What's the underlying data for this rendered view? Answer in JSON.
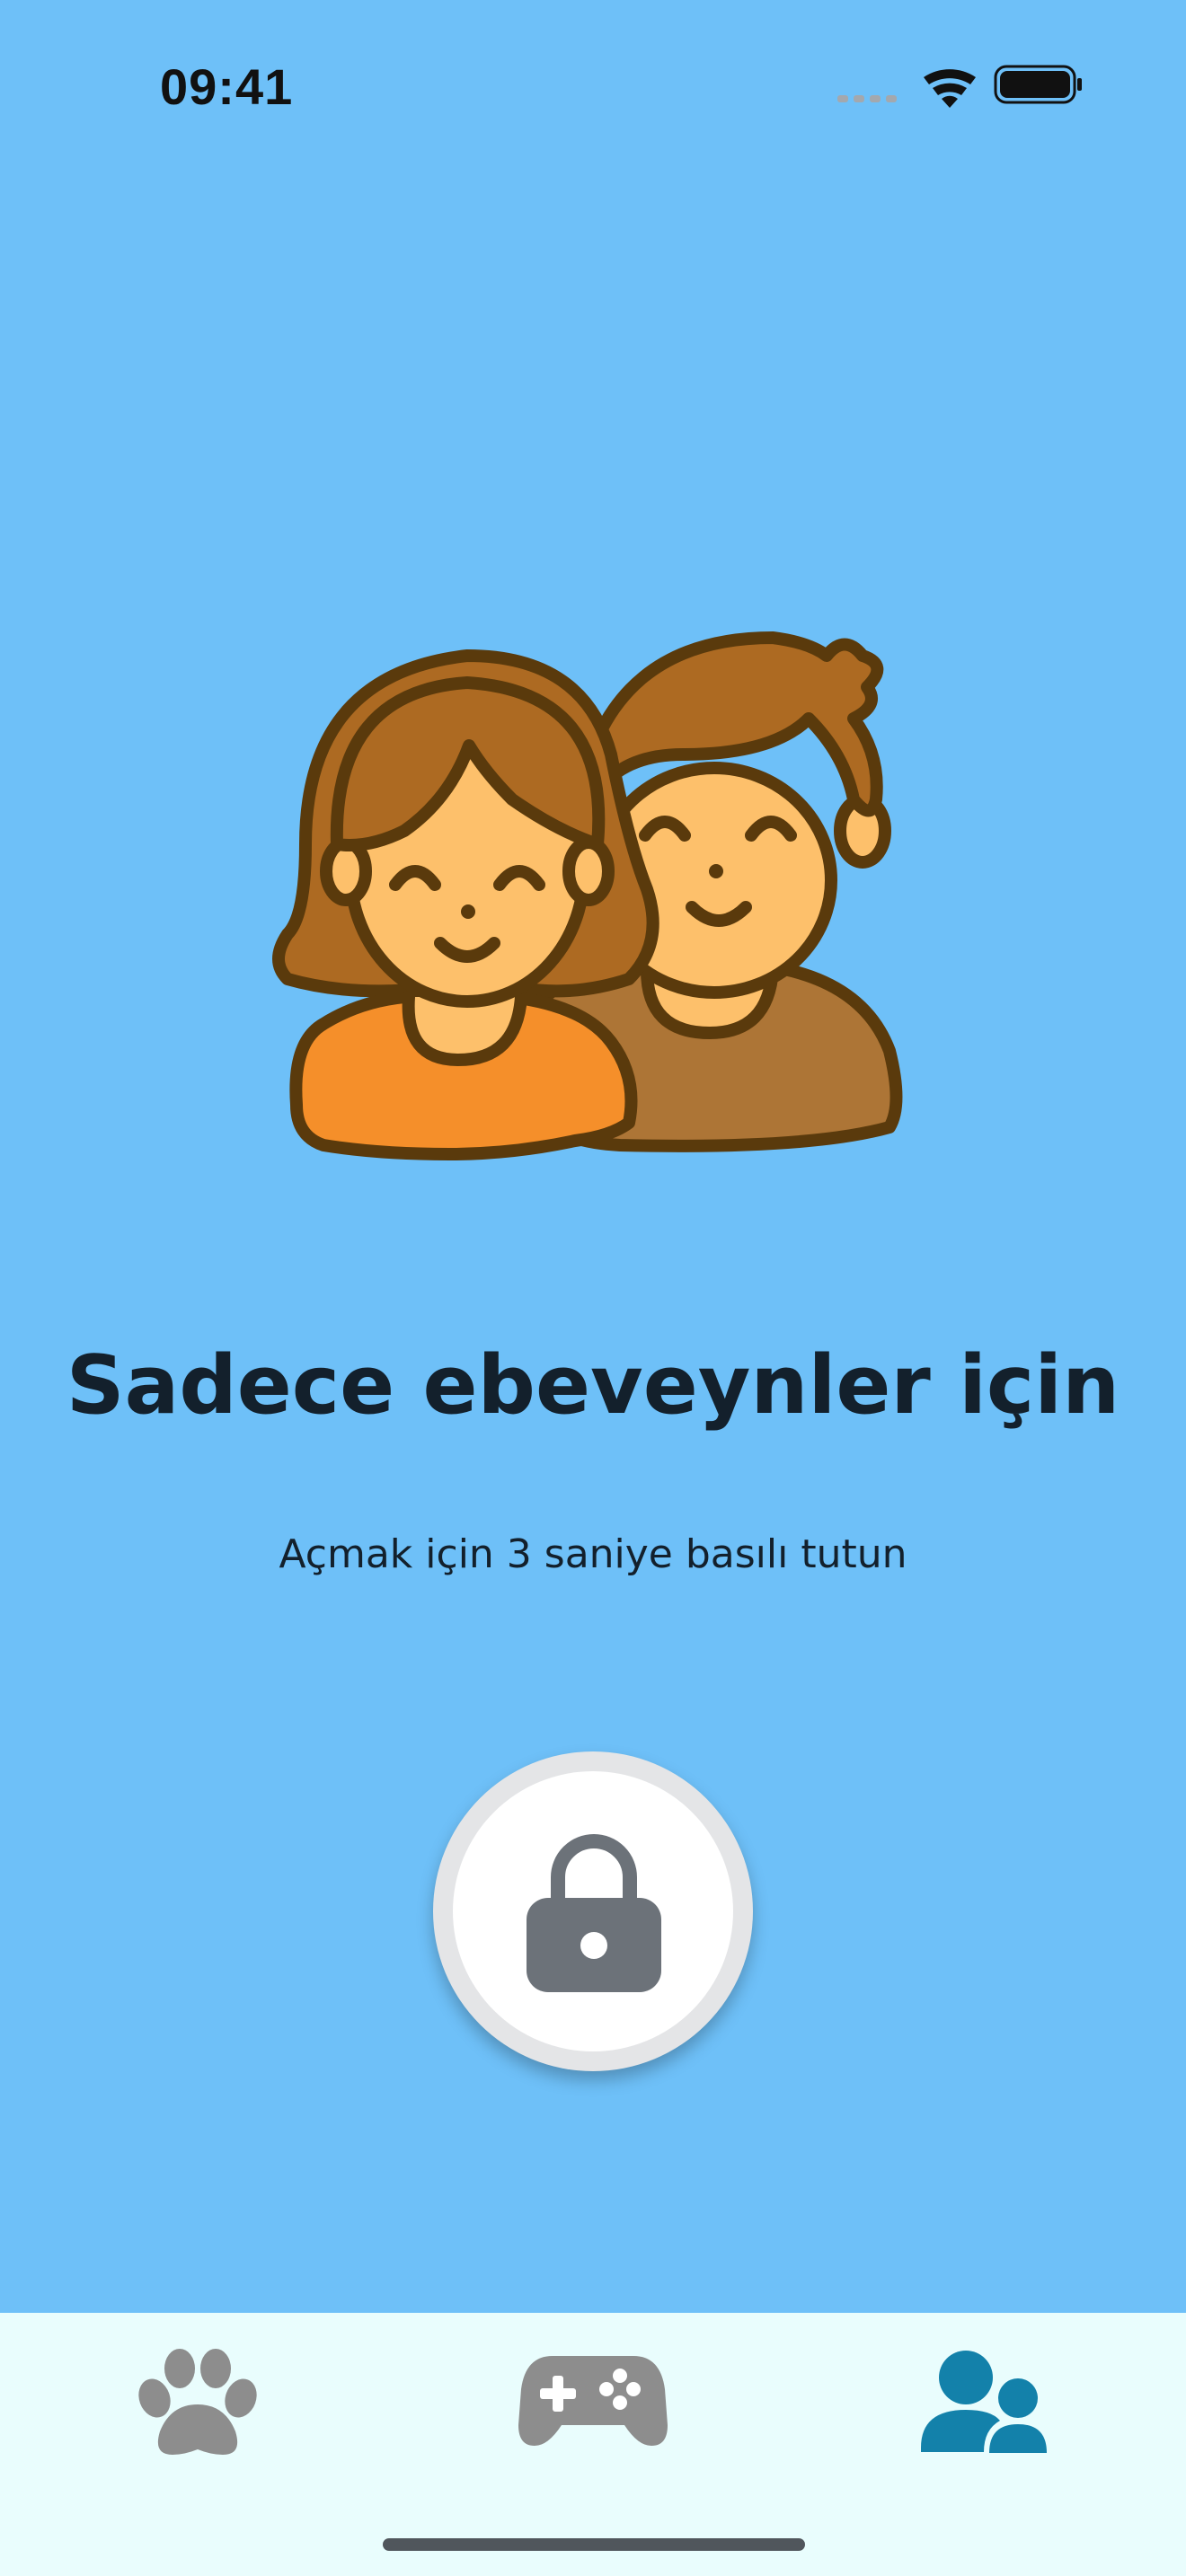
{
  "status_bar": {
    "time": "09:41",
    "icons": [
      "cellular-signal-icon",
      "wifi-icon",
      "battery-icon"
    ]
  },
  "main": {
    "illustration": "parents-icon",
    "title": "Sadece ebeveynler için",
    "subtitle": "Açmak için 3 saniye basılı tutun",
    "lock_icon": "lock-icon"
  },
  "tab_bar": {
    "tabs": [
      {
        "icon": "paw-icon",
        "selected": false
      },
      {
        "icon": "gamepad-icon",
        "selected": false
      },
      {
        "icon": "parents-tab-icon",
        "selected": true
      }
    ]
  },
  "colors": {
    "background": "#6EC0F8",
    "tab_bar": "#E9FDFD",
    "tab_selected": "#1381AA",
    "tab_unselected": "#8D8D8D",
    "lock": "#6C7279"
  }
}
